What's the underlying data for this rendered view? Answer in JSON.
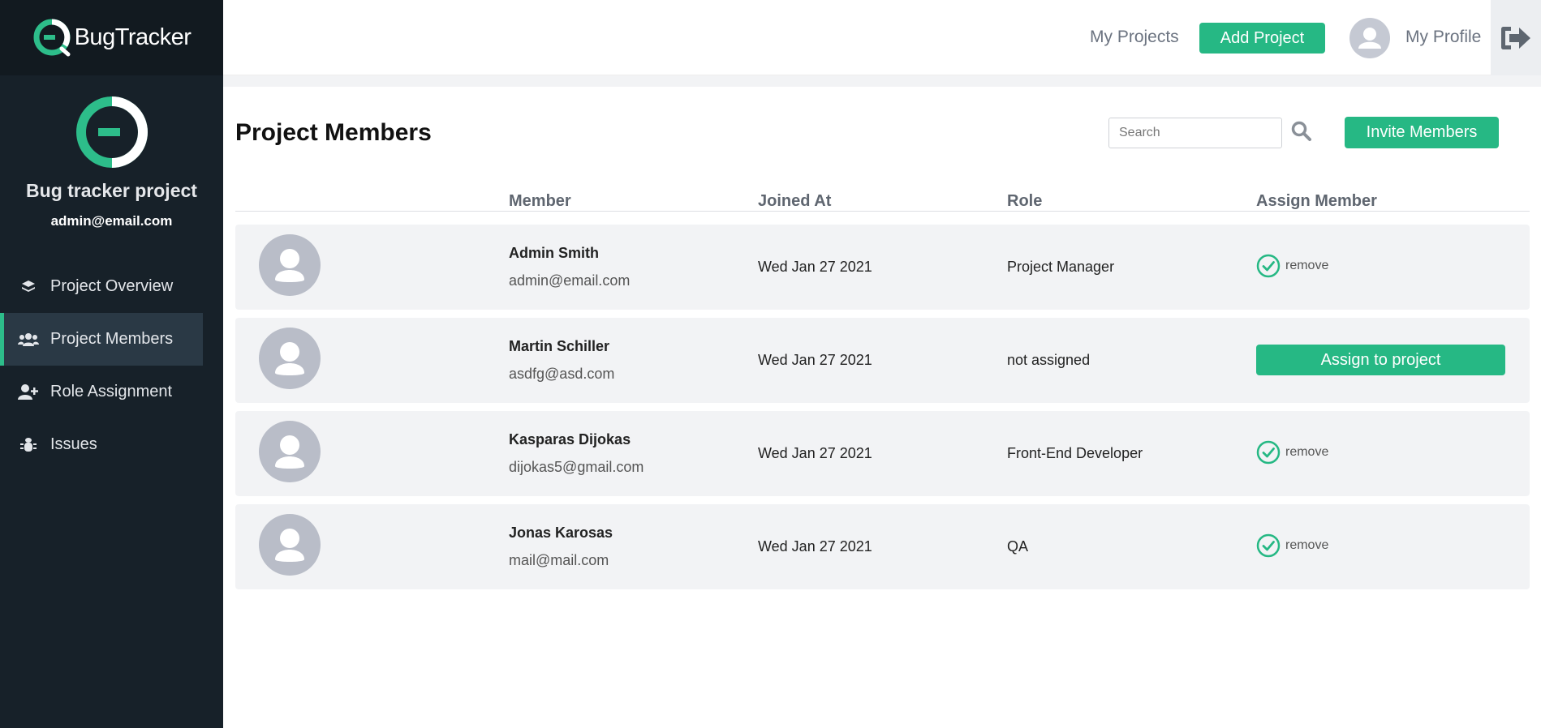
{
  "app": {
    "brand": "BugTracker"
  },
  "sidebar": {
    "project_name": "Bug tracker project",
    "project_email": "admin@email.com",
    "items": [
      {
        "label": "Project Overview",
        "icon": "layers-icon",
        "active": false
      },
      {
        "label": "Project Members",
        "icon": "users-icon",
        "active": true
      },
      {
        "label": "Role Assignment",
        "icon": "user-plus-icon",
        "active": false
      },
      {
        "label": "Issues",
        "icon": "bug-icon",
        "active": false
      }
    ]
  },
  "header": {
    "my_projects": "My Projects",
    "add_project": "Add Project",
    "my_profile": "My Profile"
  },
  "main": {
    "title": "Project Members",
    "search": {
      "placeholder": "Search",
      "value": ""
    },
    "invite_label": "Invite Members",
    "columns": [
      "Member",
      "Joined At",
      "Role",
      "Assign Member"
    ],
    "members": [
      {
        "name": "Admin Smith",
        "email": "admin@email.com",
        "joined": "Wed Jan 27 2021",
        "role": "Project Manager",
        "assigned": true,
        "action": "remove"
      },
      {
        "name": "Martin Schiller",
        "email": "asdfg@asd.com",
        "joined": "Wed Jan 27 2021",
        "role": "not assigned",
        "assigned": false,
        "action": "Assign to project"
      },
      {
        "name": "Kasparas Dijokas",
        "email": "dijokas5@gmail.com",
        "joined": "Wed Jan 27 2021",
        "role": "Front-End Developer",
        "assigned": true,
        "action": "remove"
      },
      {
        "name": "Jonas Karosas",
        "email": "mail@mail.com",
        "joined": "Wed Jan 27 2021",
        "role": "QA",
        "assigned": true,
        "action": "remove"
      }
    ]
  },
  "colors": {
    "accent": "#26b884",
    "sidebar": "#172129",
    "row": "#f2f3f5"
  }
}
